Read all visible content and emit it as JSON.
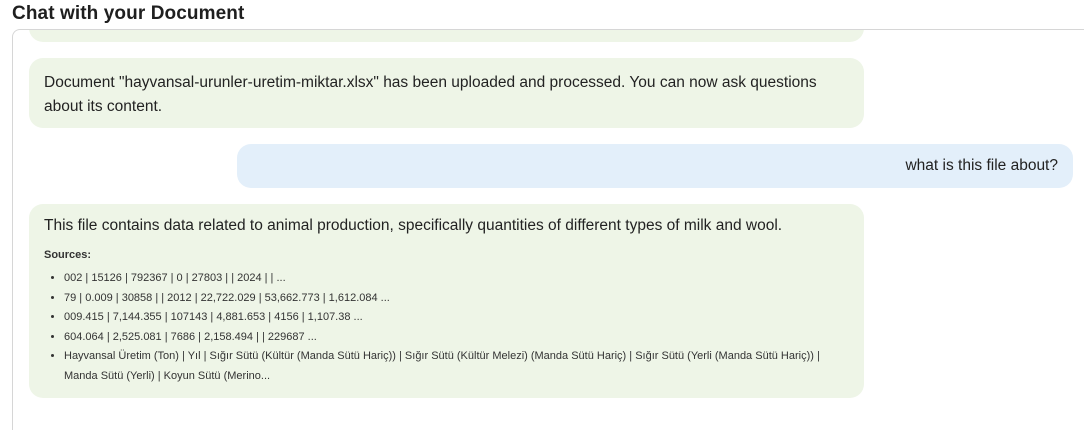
{
  "header": {
    "title": "Chat with your Document"
  },
  "messages": {
    "upload_notice": "Document \"hayvansal-urunler-uretim-miktar.xlsx\" has been uploaded and processed. You can now ask questions about its content.",
    "user_question": "what is this file about?",
    "answer": {
      "text": "This file contains data related to animal production, specifically quantities of different types of milk and wool.",
      "sources_label": "Sources:",
      "sources": [
        "002 | 15126 | 792367 | 0 | 27803 | | 2024 | | ...",
        "79 | 0.009 | 30858 | | 2012 | 22,722.029 | 53,662.773 | 1,612.084 ...",
        "009.415 | 7,144.355 | 107143 | 4,881.653 | 4156 | 1,107.38 ...",
        "604.064 | 2,525.081 | 7686 | 2,158.494 | | 229687 ...",
        "Hayvansal Üretim (Ton) | Yıl | Sığır Sütü (Kültür (Manda Sütü Hariç)) | Sığır Sütü (Kültür Melezi) (Manda Sütü Hariç) | Sığır Sütü (Yerli (Manda Sütü Hariç)) | Manda Sütü (Yerli) | Koyun Sütü (Merino..."
      ]
    }
  },
  "colors": {
    "bot_bubble": "#eef5e7",
    "user_bubble": "#e3effa"
  }
}
